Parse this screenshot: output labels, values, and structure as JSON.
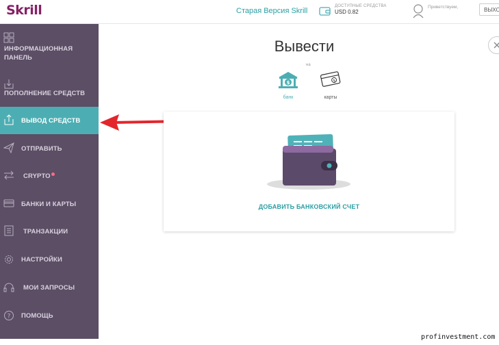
{
  "header": {
    "logo": "Skrill",
    "old_version": "Старая Версия Skrill",
    "funds_label": "ДОСТУПНЫЕ СРЕДСТВА",
    "funds_value": "USD 0.82",
    "greeting": "Приветствуем,",
    "logout": "ВЫХОД"
  },
  "sidebar": {
    "items": [
      {
        "label": "ИНФОРМАЦИОННАЯ ПАНЕЛЬ",
        "icon": "dashboard-icon"
      },
      {
        "label": "ПОПОЛНЕНИЕ СРЕДСТВ",
        "icon": "deposit-icon"
      },
      {
        "label": "ВЫВОД СРЕДСТВ",
        "icon": "withdraw-icon",
        "active": true
      },
      {
        "label": "ОТПРАВИТЬ",
        "icon": "send-icon"
      },
      {
        "label": "CRYPTO",
        "icon": "crypto-icon"
      },
      {
        "label": "БАНКИ И КАРТЫ",
        "icon": "card-icon"
      },
      {
        "label": "ТРАНЗАКЦИИ",
        "icon": "transactions-icon"
      },
      {
        "label": "НАСТРОЙКИ",
        "icon": "gear-icon"
      },
      {
        "label": "МОИ ЗАПРОСЫ",
        "icon": "headset-icon"
      },
      {
        "label": "ПОМОЩЬ",
        "icon": "help-icon"
      }
    ]
  },
  "main": {
    "title": "Вывести",
    "to_label": "на",
    "methods": [
      {
        "label": "банк",
        "icon": "bank-icon",
        "selected": true
      },
      {
        "label": "карты",
        "icon": "cards-icon",
        "selected": false
      }
    ],
    "add_account": "ДОБАВИТЬ БАНКОВСКИЙ СЧЕТ"
  },
  "watermark": "profinvestment.com",
  "colors": {
    "brand": "#862165",
    "sidebar": "#5b4e65",
    "accent": "#4caeb3",
    "arrow": "#e3262c"
  }
}
